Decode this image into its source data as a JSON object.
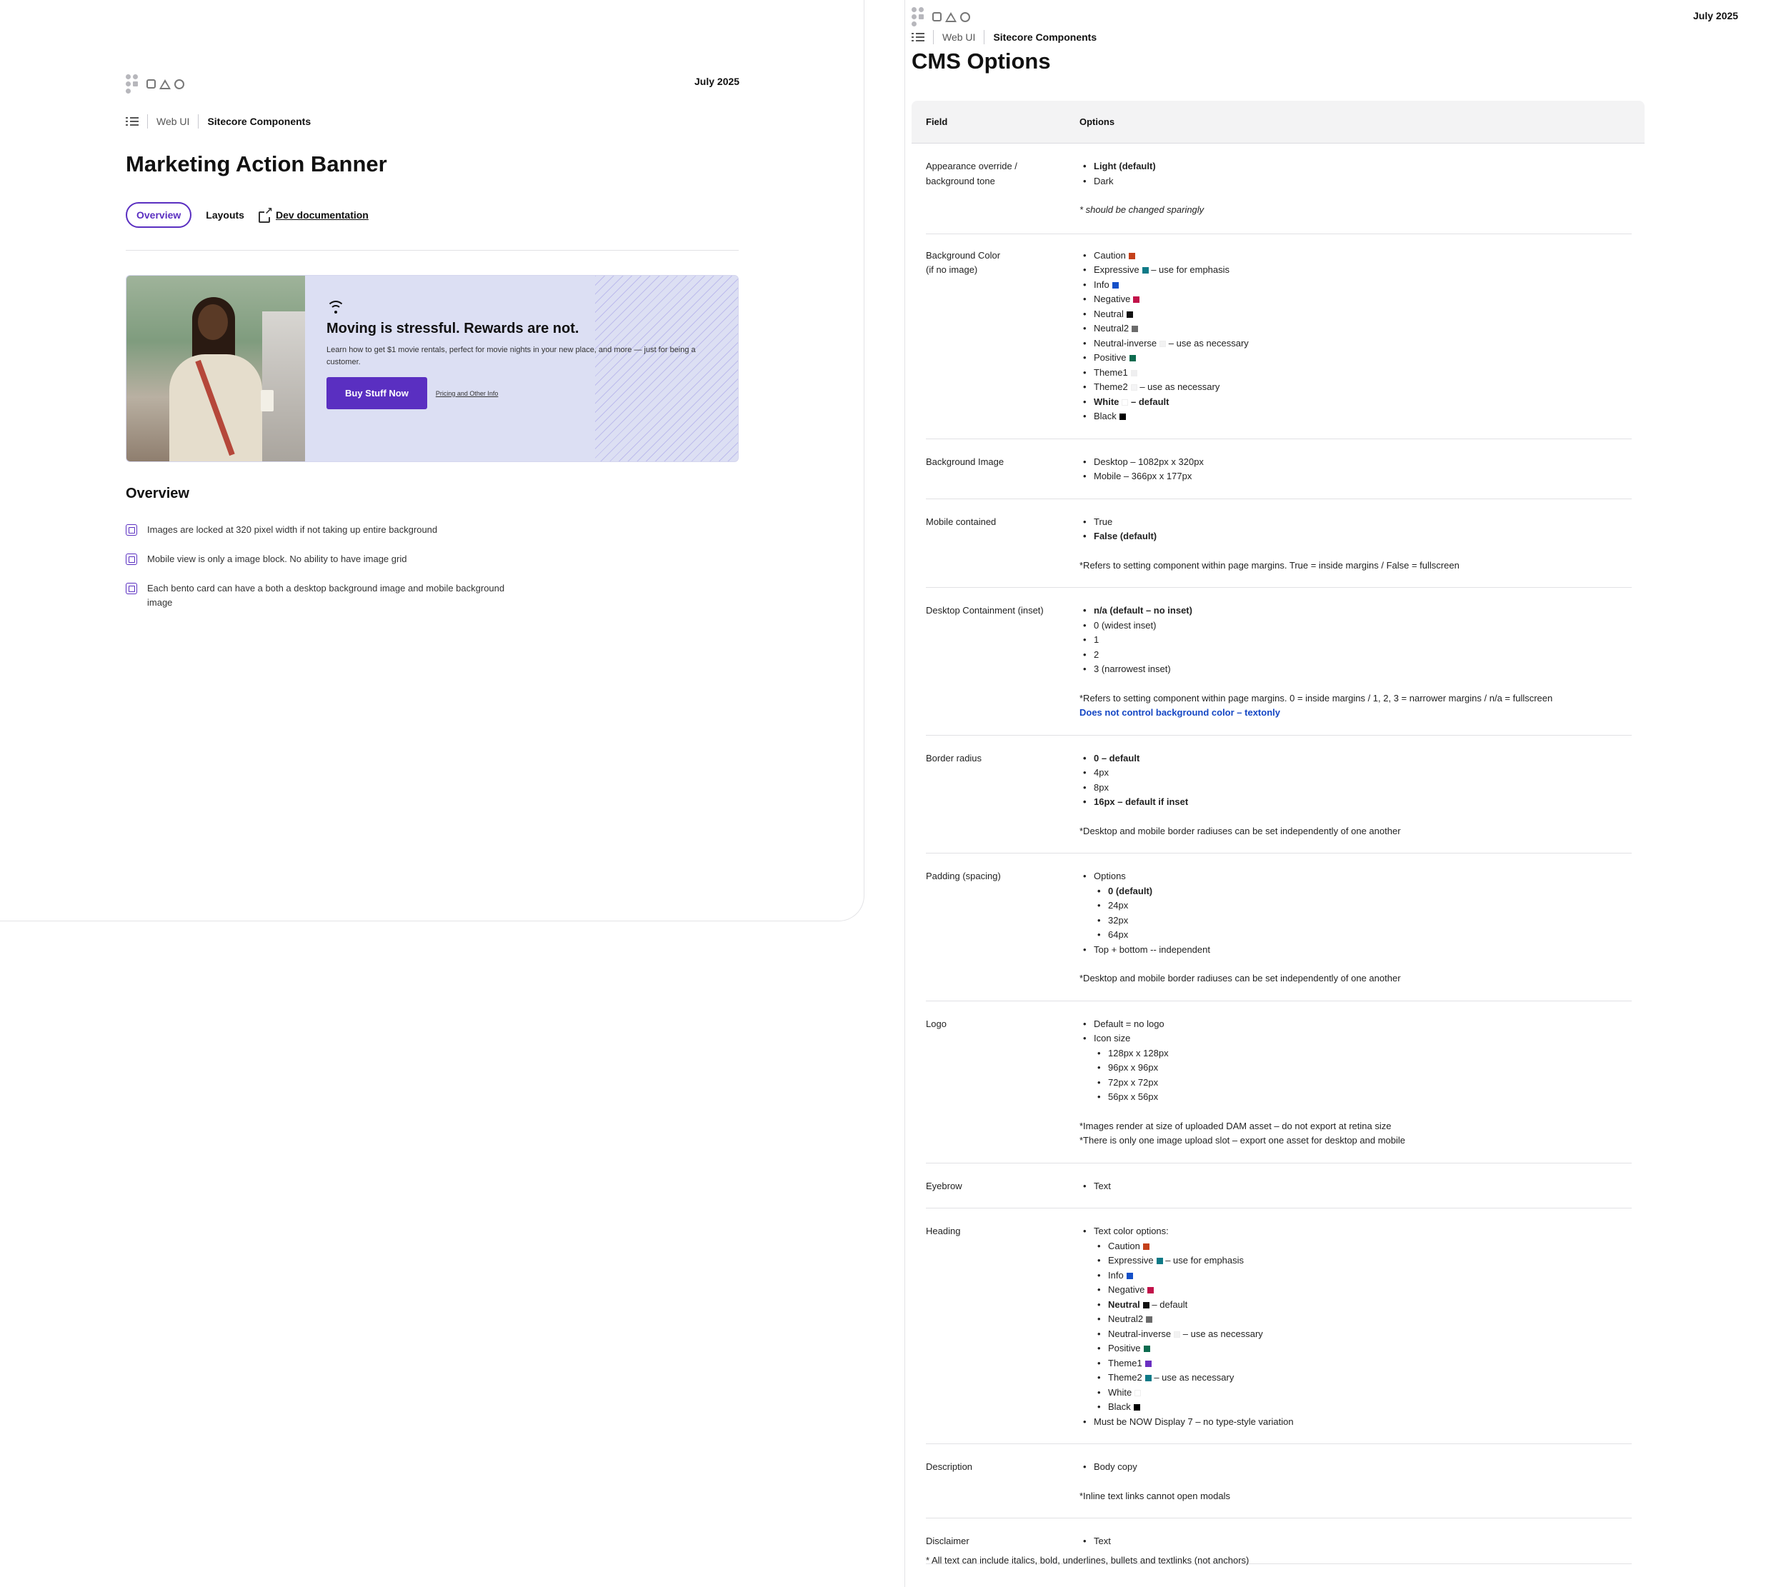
{
  "left": {
    "date": "July 2025",
    "breadcrumbs": [
      "Web UI",
      "Sitecore Components"
    ],
    "title": "Marketing Action Banner",
    "tabs": {
      "overview": "Overview",
      "layouts": "Layouts",
      "dev": "Dev documentation"
    },
    "banner": {
      "heading": "Moving is stressful. Rewards are not.",
      "description": "Learn how to get $1 movie rentals, perfect for movie nights in your new place, and more — just for being a customer.",
      "button": "Buy Stuff Now",
      "link": "Pricing and Other Info"
    },
    "overview": {
      "heading": "Overview",
      "items": [
        "Images are locked at 320 pixel width if not taking up entire background",
        "Mobile view is only a image block.  No ability to have image grid",
        "Each bento card can have a both a desktop background image and mobile background image"
      ]
    }
  },
  "right": {
    "date": "July 2025",
    "breadcrumbs": [
      "Web UI",
      "Sitecore Components"
    ],
    "title": "CMS Options",
    "table": {
      "headers": [
        "Field",
        "Options"
      ],
      "rows": {
        "appearance": {
          "field": "Appearance override / background tone",
          "items": [
            "Light (default)",
            "Dark"
          ],
          "note": "* should be changed sparingly"
        },
        "bgcolor": {
          "field_l1": "Background Color",
          "field_l2": "(if no image)",
          "items": [
            {
              "name": "Caution",
              "color": "#c4401a",
              "suffix": ""
            },
            {
              "name": "Expressive",
              "color": "#0f7a87",
              "suffix": " – use for emphasis"
            },
            {
              "name": "Info",
              "color": "#1550c8",
              "suffix": ""
            },
            {
              "name": "Negative",
              "color": "#c2124a",
              "suffix": ""
            },
            {
              "name": "Neutral",
              "color": "#111111",
              "suffix": ""
            },
            {
              "name": "Neutral2",
              "color": "#6b6b6b",
              "suffix": ""
            },
            {
              "name": "Neutral-inverse",
              "color": "#f2f2f2",
              "suffix": " – use as necessary"
            },
            {
              "name": "Positive",
              "color": "#0d6b4f",
              "suffix": ""
            },
            {
              "name": "Theme1",
              "color": "#efeff0",
              "suffix": ""
            },
            {
              "name": "Theme2",
              "color": "#f4f4f5",
              "suffix": " – use as necessary"
            },
            {
              "name": "White",
              "color": "#ffffff",
              "suffix": " – default"
            },
            {
              "name": "Black",
              "color": "#000000",
              "suffix": ""
            }
          ]
        },
        "bgimage": {
          "field": "Background Image",
          "items": [
            "Desktop – 1082px x 320px",
            "Mobile – 366px x 177px"
          ]
        },
        "mobile": {
          "field": "Mobile contained",
          "items": [
            "True",
            "False (default)"
          ],
          "note": "*Refers to setting component within page margins. True = inside margins / False = fullscreen"
        },
        "desktop": {
          "field": "Desktop Containment (inset)",
          "items": [
            "n/a (default – no inset)",
            "0 (widest inset)",
            "1",
            "2",
            "3 (narrowest inset)"
          ],
          "note": "*Refers to setting component within page margins. 0 = inside margins / 1, 2, 3 = narrower margins / n/a = fullscreen",
          "note2": "Does not control background color – textonly"
        },
        "radius": {
          "field": "Border radius",
          "items": [
            "0 – default",
            "4px",
            "8px",
            "16px – default if inset"
          ],
          "note": "*Desktop and mobile border radiuses can be set independently of one another"
        },
        "padding": {
          "field": "Padding (spacing)",
          "items": [
            "Options",
            "Top + bottom -- independent"
          ],
          "sub": [
            "0 (default)",
            "24px",
            "32px",
            "64px"
          ],
          "note": "*Desktop and mobile border radiuses can be set independently of one another"
        },
        "logo": {
          "field": "Logo",
          "items": [
            "Default = no logo",
            "Icon size"
          ],
          "sub": [
            "128px x 128px",
            "96px x 96px",
            "72px x 72px",
            "56px x 56px"
          ],
          "note": "*Images render at size of uploaded DAM asset – do not export at retina size",
          "note2": "*There is only one image upload slot – export one asset for desktop and mobile"
        },
        "eyebrow": {
          "field": "Eyebrow",
          "items": [
            "Text"
          ]
        },
        "heading": {
          "field": "Heading",
          "items": [
            "Text color options:",
            "Must be NOW Display 7 – no type-style variation"
          ],
          "sub": [
            {
              "name": "Caution",
              "color": "#c4401a",
              "suffix": ""
            },
            {
              "name": "Expressive",
              "color": "#0f7a87",
              "suffix": " – use for emphasis"
            },
            {
              "name": "Info",
              "color": "#1550c8",
              "suffix": ""
            },
            {
              "name": "Negative",
              "color": "#c2124a",
              "suffix": ""
            },
            {
              "name": "Neutral",
              "color": "#111111",
              "suffix": " – default"
            },
            {
              "name": "Neutral2",
              "color": "#6b6b6b",
              "suffix": ""
            },
            {
              "name": "Neutral-inverse",
              "color": "#f2f2f2",
              "suffix": " – use as necessary"
            },
            {
              "name": "Positive",
              "color": "#0d6b4f",
              "suffix": ""
            },
            {
              "name": "Theme1",
              "color": "#6a2fc1",
              "suffix": ""
            },
            {
              "name": "Theme2",
              "color": "#0f7a87",
              "suffix": " – use as necessary"
            },
            {
              "name": "White",
              "color": "#ffffff",
              "suffix": ""
            },
            {
              "name": "Black",
              "color": "#000000",
              "suffix": ""
            }
          ]
        },
        "description": {
          "field": "Description",
          "items": [
            "Body copy"
          ],
          "note": "*Inline text links cannot open modals"
        },
        "disclaimer": {
          "field": "Disclaimer",
          "items": [
            "Text"
          ]
        }
      }
    },
    "footnote": "* All text can include italics, bold, underlines, bullets and textlinks (not anchors)"
  },
  "colors": {
    "accent": "#5a2fc1",
    "link_blue": "#1547c4",
    "banner_bg": "#dcdff3"
  }
}
